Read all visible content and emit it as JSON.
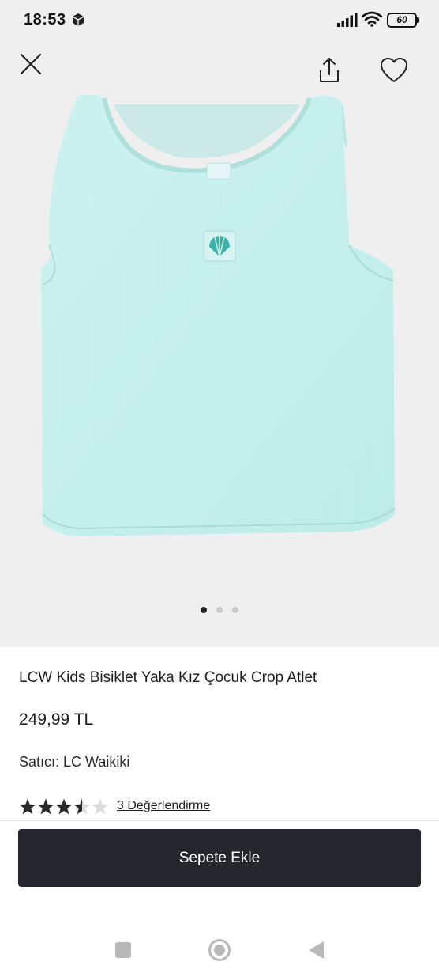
{
  "status_bar": {
    "time": "18:53",
    "battery": "60"
  },
  "hero": {
    "background": "#efefef",
    "garment_color": "#c9f0ee",
    "image_description_icon": "tank-top-image",
    "carousel": {
      "count": 3,
      "active": 1
    }
  },
  "product": {
    "title": "LCW Kids Bisiklet Yaka Kız Çocuk Crop Atlet",
    "price": "249,99 TL",
    "seller_label": "Satıcı:",
    "seller_name": "LC Waikiki",
    "rating": 3.5,
    "rating_max": 5,
    "reviews_text": "3 Değerlendirme"
  },
  "actions": {
    "add_to_cart_label": "Sepete Ekle",
    "button_color": "#24262b"
  },
  "icons": {
    "close": "close-icon",
    "share": "share-icon",
    "favorite": "heart-icon"
  }
}
